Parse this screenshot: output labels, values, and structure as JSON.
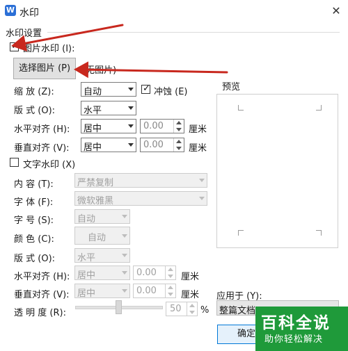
{
  "window": {
    "title": "水印",
    "app_icon": "W",
    "close": "✕"
  },
  "group": {
    "title": "水印设置"
  },
  "picture": {
    "checkbox_label": "图片水印 (I):",
    "checked": true,
    "select_button": "选择图片 (P)",
    "no_image": "(无图片)",
    "scale_label": "缩  放 (Z):",
    "scale_value": "自动",
    "washout_label": "冲蚀 (E)",
    "washout_checked": true,
    "layout_label": "版  式 (O):",
    "layout_value": "水平",
    "halign_label": "水平对齐 (H):",
    "halign_value": "居中",
    "halign_num": "0.00",
    "valign_label": "垂直对齐 (V):",
    "valign_value": "居中",
    "valign_num": "0.00",
    "unit": "厘米"
  },
  "text": {
    "checkbox_label": "文字水印 (X)",
    "checked": false,
    "content_label": "内  容 (T):",
    "content_value": "严禁复制",
    "font_label": "字  体 (F):",
    "font_value": "微软雅黑",
    "size_label": "字  号 (S):",
    "size_value": "自动",
    "color_label": "颜  色 (C):",
    "color_value": "自动",
    "layout_label": "版  式 (O):",
    "layout_value": "水平",
    "halign_label": "水平对齐 (H):",
    "halign_value": "居中",
    "halign_num": "0.00",
    "valign_label": "垂直对齐 (V):",
    "valign_value": "居中",
    "valign_num": "0.00",
    "unit": "厘米",
    "transparency_label": "透 明 度 (R):",
    "transparency_value": "50",
    "transparency_unit": "%"
  },
  "preview": {
    "label": "预览"
  },
  "apply": {
    "label": "应用于 (Y):",
    "value": "整篇文档"
  },
  "buttons": {
    "ok": "确定"
  },
  "watermark": {
    "main": "百科全说",
    "sub": "助你轻松解决"
  },
  "colors": {
    "arrow": "#c8281e",
    "watermark_bg": "#1f9a3a",
    "app_icon": "#2b6fd6"
  }
}
